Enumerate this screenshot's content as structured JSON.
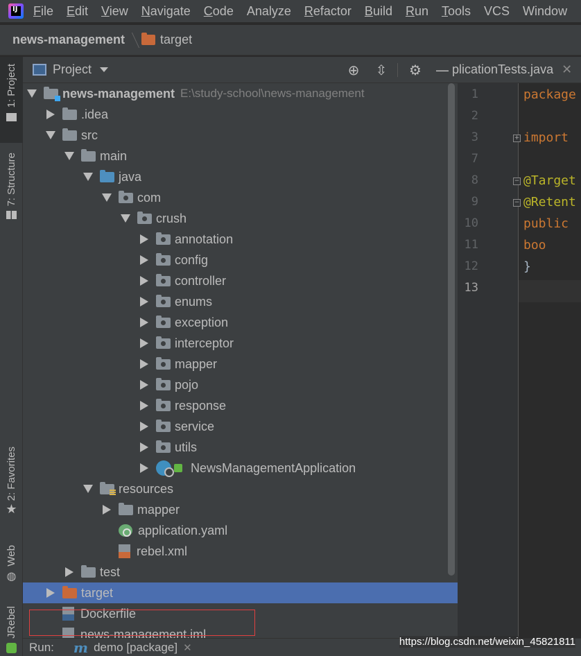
{
  "menu": {
    "items": [
      {
        "label": "File",
        "mnemonic": "F",
        "rest": "ile"
      },
      {
        "label": "Edit",
        "mnemonic": "E",
        "rest": "dit"
      },
      {
        "label": "View",
        "mnemonic": "V",
        "rest": "iew"
      },
      {
        "label": "Navigate",
        "mnemonic": "N",
        "rest": "avigate"
      },
      {
        "label": "Code",
        "mnemonic": "C",
        "rest": "ode"
      },
      {
        "label": "Analyze",
        "mnemonic": "",
        "rest": "Analyze"
      },
      {
        "label": "Refactor",
        "mnemonic": "R",
        "rest": "efactor"
      },
      {
        "label": "Build",
        "mnemonic": "B",
        "rest": "uild"
      },
      {
        "label": "Run",
        "mnemonic": "R",
        "rest": "un"
      },
      {
        "label": "Tools",
        "mnemonic": "T",
        "rest": "ools"
      },
      {
        "label": "VCS",
        "mnemonic": "",
        "rest": "VCS"
      },
      {
        "label": "Window",
        "mnemonic": "",
        "rest": "Windo"
      }
    ]
  },
  "breadcrumb": {
    "root": "news-management",
    "current": "target"
  },
  "left_strip": {
    "project": "1: Project",
    "structure": "7: Structure",
    "favorites": "2: Favorites",
    "web": "Web",
    "jrebel": "JRebel"
  },
  "panel": {
    "title": "Project"
  },
  "tree": [
    {
      "label": "news-management",
      "path": "E:\\study-school\\news-management",
      "depth": 0,
      "state": "expanded",
      "icon": "module-folder",
      "bold": true
    },
    {
      "label": ".idea",
      "depth": 1,
      "state": "collapsed",
      "icon": "folder"
    },
    {
      "label": "src",
      "depth": 1,
      "state": "expanded",
      "icon": "folder"
    },
    {
      "label": "main",
      "depth": 2,
      "state": "expanded",
      "icon": "folder"
    },
    {
      "label": "java",
      "depth": 3,
      "state": "expanded",
      "icon": "source-folder"
    },
    {
      "label": "com",
      "depth": 4,
      "state": "expanded",
      "icon": "package"
    },
    {
      "label": "crush",
      "depth": 5,
      "state": "expanded",
      "icon": "package"
    },
    {
      "label": "annotation",
      "depth": 6,
      "state": "collapsed",
      "icon": "package"
    },
    {
      "label": "config",
      "depth": 6,
      "state": "collapsed",
      "icon": "package"
    },
    {
      "label": "controller",
      "depth": 6,
      "state": "collapsed",
      "icon": "package"
    },
    {
      "label": "enums",
      "depth": 6,
      "state": "collapsed",
      "icon": "package"
    },
    {
      "label": "exception",
      "depth": 6,
      "state": "collapsed",
      "icon": "package"
    },
    {
      "label": "interceptor",
      "depth": 6,
      "state": "collapsed",
      "icon": "package"
    },
    {
      "label": "mapper",
      "depth": 6,
      "state": "collapsed",
      "icon": "package"
    },
    {
      "label": "pojo",
      "depth": 6,
      "state": "collapsed",
      "icon": "package"
    },
    {
      "label": "response",
      "depth": 6,
      "state": "collapsed",
      "icon": "package"
    },
    {
      "label": "service",
      "depth": 6,
      "state": "collapsed",
      "icon": "package"
    },
    {
      "label": "utils",
      "depth": 6,
      "state": "collapsed",
      "icon": "package"
    },
    {
      "label": "NewsManagementApplication",
      "depth": 6,
      "state": "collapsed",
      "icon": "spring-app-class"
    },
    {
      "label": "resources",
      "depth": 3,
      "state": "expanded",
      "icon": "resources-folder"
    },
    {
      "label": "mapper",
      "depth": 4,
      "state": "collapsed",
      "icon": "folder"
    },
    {
      "label": "application.yaml",
      "depth": 4,
      "state": "leaf",
      "icon": "spring-config"
    },
    {
      "label": "rebel.xml",
      "depth": 4,
      "state": "leaf",
      "icon": "xml-file"
    },
    {
      "label": "test",
      "depth": 2,
      "state": "collapsed",
      "icon": "folder"
    },
    {
      "label": "target",
      "depth": 1,
      "state": "collapsed",
      "icon": "excluded-folder",
      "selected": true
    },
    {
      "label": "Dockerfile",
      "depth": 1,
      "state": "leaf",
      "icon": "docker-file"
    },
    {
      "label": "news-management.iml",
      "depth": 1,
      "state": "leaf",
      "icon": "iml-file"
    }
  ],
  "editor": {
    "tab_label": "plicationTests.java",
    "lines": [
      {
        "num": "1",
        "code": "package",
        "cls": "kw"
      },
      {
        "num": "2",
        "code": "",
        "cls": "plain"
      },
      {
        "num": "3",
        "code": "import",
        "cls": "kw"
      },
      {
        "num": "7",
        "code": "",
        "cls": "plain"
      },
      {
        "num": "8",
        "code": "@Target",
        "cls": "ann"
      },
      {
        "num": "9",
        "code": "@Retent",
        "cls": "ann"
      },
      {
        "num": "10",
        "code": "public",
        "cls": "kw"
      },
      {
        "num": "11",
        "code": "    boo",
        "cls": "kw"
      },
      {
        "num": "12",
        "code": "}",
        "cls": "plain"
      },
      {
        "num": "13",
        "code": "",
        "cls": "plain"
      }
    ]
  },
  "runbar": {
    "label": "Run:",
    "tab": "demo [package]",
    "watermark": "https://blog.csdn.net/weixin_45821811"
  },
  "colors": {
    "selection": "#4b6eaf",
    "keyword": "#cc7832",
    "annotation": "#bbb529",
    "excluded_folder": "#c8693a"
  }
}
